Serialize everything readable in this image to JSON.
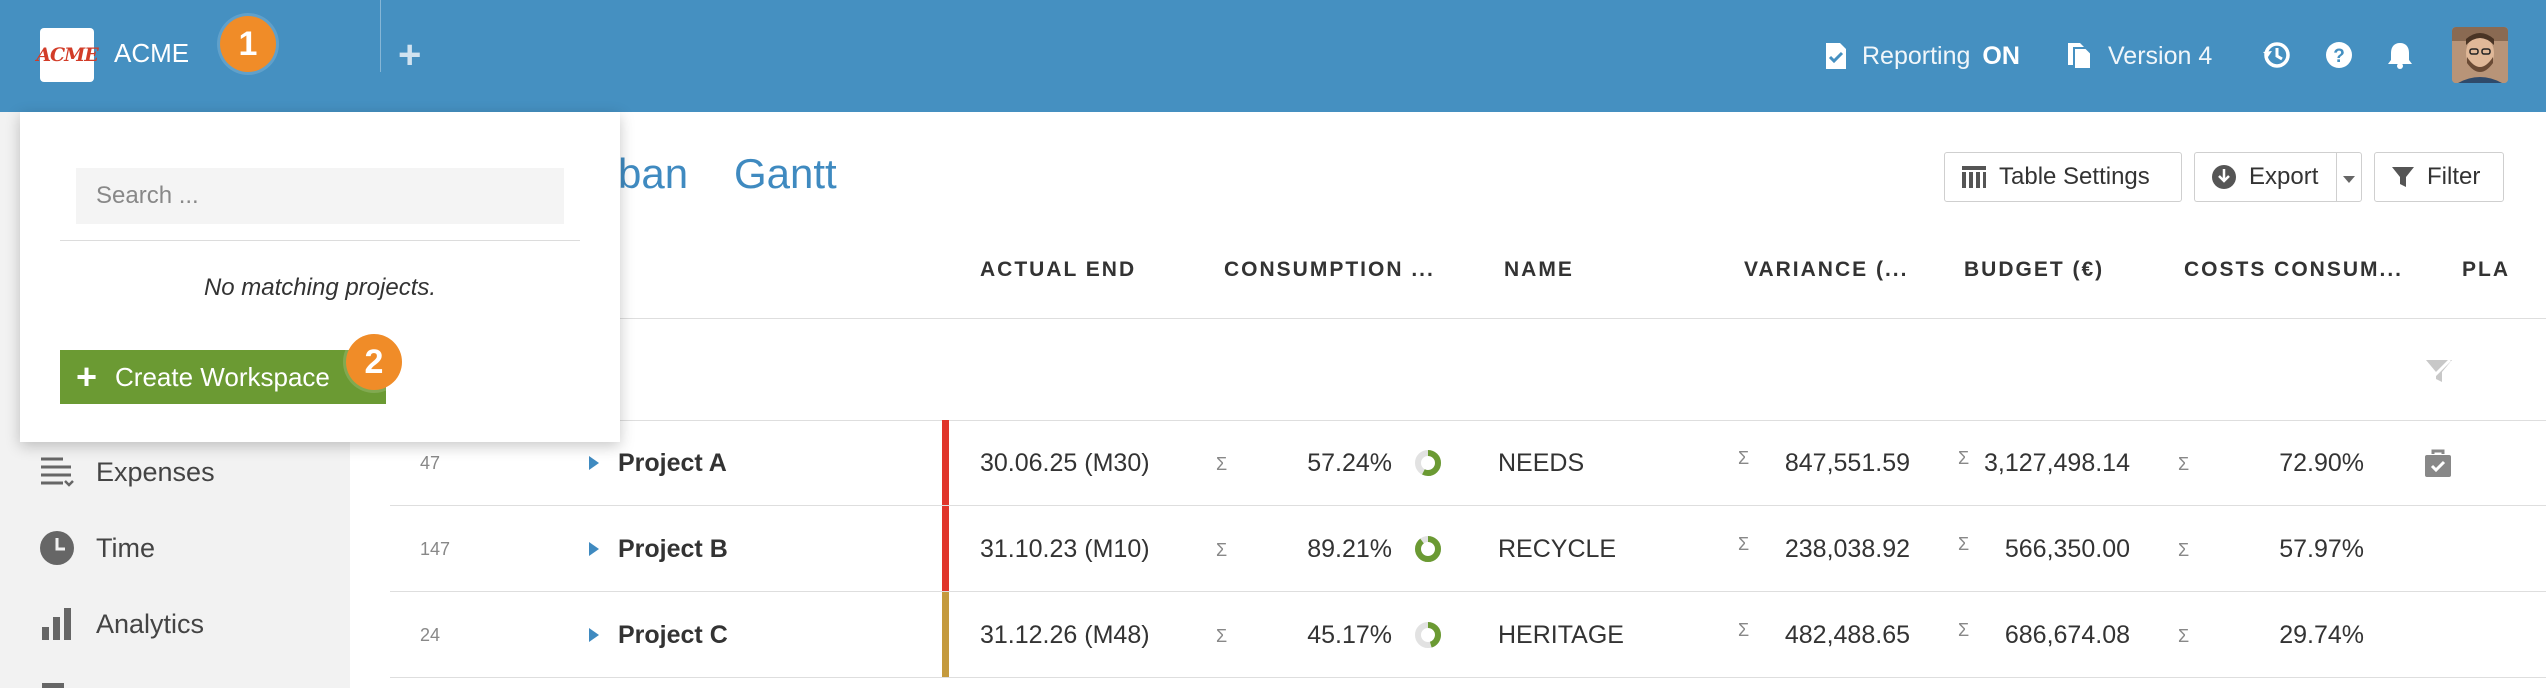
{
  "header": {
    "logo_text": "ACME",
    "company": "ACME",
    "badge1": "1",
    "add_label": "+",
    "reporting_label": "Reporting",
    "reporting_state": "ON",
    "version_label": "Version 4"
  },
  "dropdown": {
    "search_placeholder": "Search ...",
    "empty_message": "No matching projects.",
    "create_label": "Create Workspace",
    "badge2": "2"
  },
  "sidebar": {
    "items": [
      {
        "label": "Expenses",
        "icon": "expenses-icon"
      },
      {
        "label": "Time",
        "icon": "clock-icon"
      },
      {
        "label": "Analytics",
        "icon": "bar-chart-icon"
      }
    ]
  },
  "views": {
    "kanban_partial": "ban",
    "gantt": "Gantt"
  },
  "toolbar": {
    "table_settings": "Table Settings",
    "export": "Export",
    "filter": "Filter"
  },
  "table": {
    "columns": [
      "ACTUAL END",
      "CONSUMPTION ...",
      "NAME",
      "VARIANCE (...",
      "BUDGET (€)",
      "COSTS CONSUM...",
      "PLA"
    ],
    "sigma": "Σ",
    "rows": [
      {
        "id": "47",
        "name": "Project A",
        "actual_end": "30.06.25 (M30)",
        "consumption": "57.24%",
        "consumption_value": 57.24,
        "label": "NEEDS",
        "variance": "847,551.59",
        "budget": "3,127,498.14",
        "costs": "72.90%",
        "status_color": "#e0352b"
      },
      {
        "id": "147",
        "name": "Project B",
        "actual_end": "31.10.23 (M10)",
        "consumption": "89.21%",
        "consumption_value": 89.21,
        "label": "RECYCLE",
        "variance": "238,038.92",
        "budget": "566,350.00",
        "costs": "57.97%",
        "status_color": "#e0352b"
      },
      {
        "id": "24",
        "name": "Project C",
        "actual_end": "31.12.26 (M48)",
        "consumption": "45.17%",
        "consumption_value": 45.17,
        "label": "HERITAGE",
        "variance": "482,488.65",
        "budget": "686,674.08",
        "costs": "29.74%",
        "status_color": "#c49a3e"
      }
    ]
  },
  "colors": {
    "topbar": "#4590c1",
    "accent_green": "#6b9a33",
    "badge_orange": "#f08c28",
    "link_blue": "#3f8ac0"
  }
}
